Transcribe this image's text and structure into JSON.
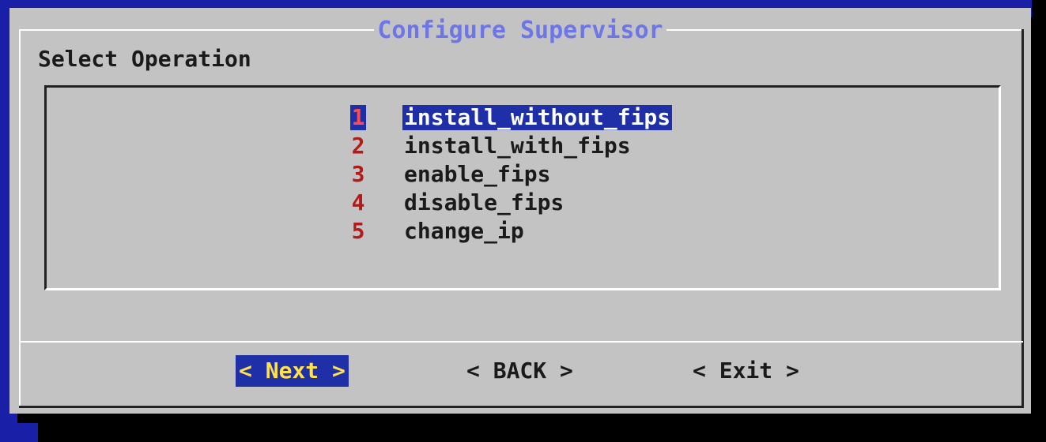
{
  "dialog": {
    "title": "Configure Supervisor",
    "prompt": "Select Operation"
  },
  "menu": {
    "selected_index": 0,
    "items": [
      {
        "number": "1",
        "label": "install_without_fips"
      },
      {
        "number": "2",
        "label": "install_with_fips"
      },
      {
        "number": "3",
        "label": "enable_fips"
      },
      {
        "number": "4",
        "label": "disable_fips"
      },
      {
        "number": "5",
        "label": "change_ip"
      }
    ]
  },
  "buttons": {
    "next_label": "< Next >",
    "back_label": "< BACK >",
    "exit_label": "< Exit >",
    "focused": "next"
  },
  "colors": {
    "background": "#1a1fa8",
    "dialog": "#c3c3c3",
    "title": "#6d76e6",
    "highlight": "#1e2fa8",
    "menu_number": "#b31a1a",
    "focused_button_text": "#ffe14d"
  }
}
